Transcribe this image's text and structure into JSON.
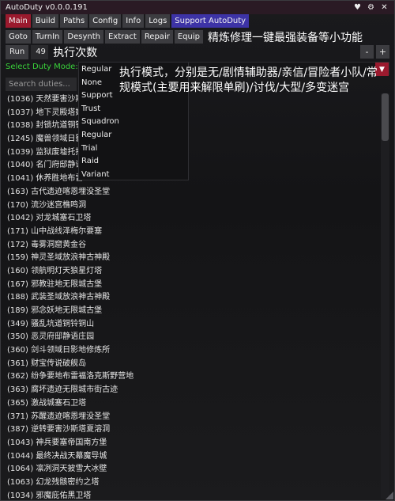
{
  "window": {
    "title": "AutoDuty v0.0.0.191"
  },
  "tabs": [
    "Main",
    "Build",
    "Paths",
    "Config",
    "Info",
    "Logs",
    "Support AutoDuty"
  ],
  "buttons": [
    "Goto",
    "TurnIn",
    "Desynth",
    "Extract",
    "Repair",
    "Equip"
  ],
  "button_annotation": "精炼修理一键最强装备等小功能",
  "run": {
    "label": "Run",
    "value": "49",
    "annotation": "执行次数",
    "minus": "-",
    "plus": "+"
  },
  "mode": {
    "label": "Select Duty Mode:",
    "selected": "Regular"
  },
  "search": {
    "placeholder": "Search duties..."
  },
  "dropdown_options": [
    "Regular",
    "None",
    "Support",
    "Trust",
    "Squadron",
    "Regular",
    "Trial",
    "Raid",
    "Variant"
  ],
  "mode_annotation": "执行模式，分别是无/剧情辅助器/亲信/冒险者小队/常规模式(主要用来解限单刷)/讨伐/大型/多变迷宫",
  "duties": [
    "(1036) 天然要害沙斯",
    "(1037) 地下灵殿塔姆",
    "(1038) 封锁坑道铜铃",
    "(1245) 魔兽领域日影",
    "(1039) 监狱废墟托托",
    "(1040) 名门府邸静语",
    "(1041) 休养胜地布雷",
    "(163) 古代遗迹喀恩埋没圣堂",
    "(170) 流沙迷宫樵鸣洞",
    "(1042) 对龙城塞石卫塔",
    "(171) 山中战线泽梅尔要塞",
    "(172) 毒雾洞窟黄金谷",
    "(159) 神灵圣域放浪神古神殿",
    "(160) 领航明灯天狼星灯塔",
    "(167) 邪教驻地无限城古堡",
    "(188) 武装圣域放浪神古神殿",
    "(189) 邪念妖地无限城古堡",
    "(349) 骚乱坑道铜铃铜山",
    "(350) 恶灵府邸静语庄园",
    "(360) 剑斗领域日影地修炼所",
    "(361) 财宝传说破舰岛",
    "(362) 纷争要地布雷福洛克斯野营地",
    "(363) 腐坏遗迹无限城市街古迹",
    "(365) 激战城塞石卫塔",
    "(371) 苏醒遗迹喀恩埋没圣堂",
    "(387) 逆转要害沙斯塔夏溶洞",
    "(1043) 神兵要塞帝国南方堡",
    "(1044) 最终决战天幕魔导城",
    "(1064) 凛冽洞天披雪大冰壁",
    "(1063) 幻龙残骸密约之塔",
    "(1034) 邪魔庇佑黑卫塔"
  ]
}
